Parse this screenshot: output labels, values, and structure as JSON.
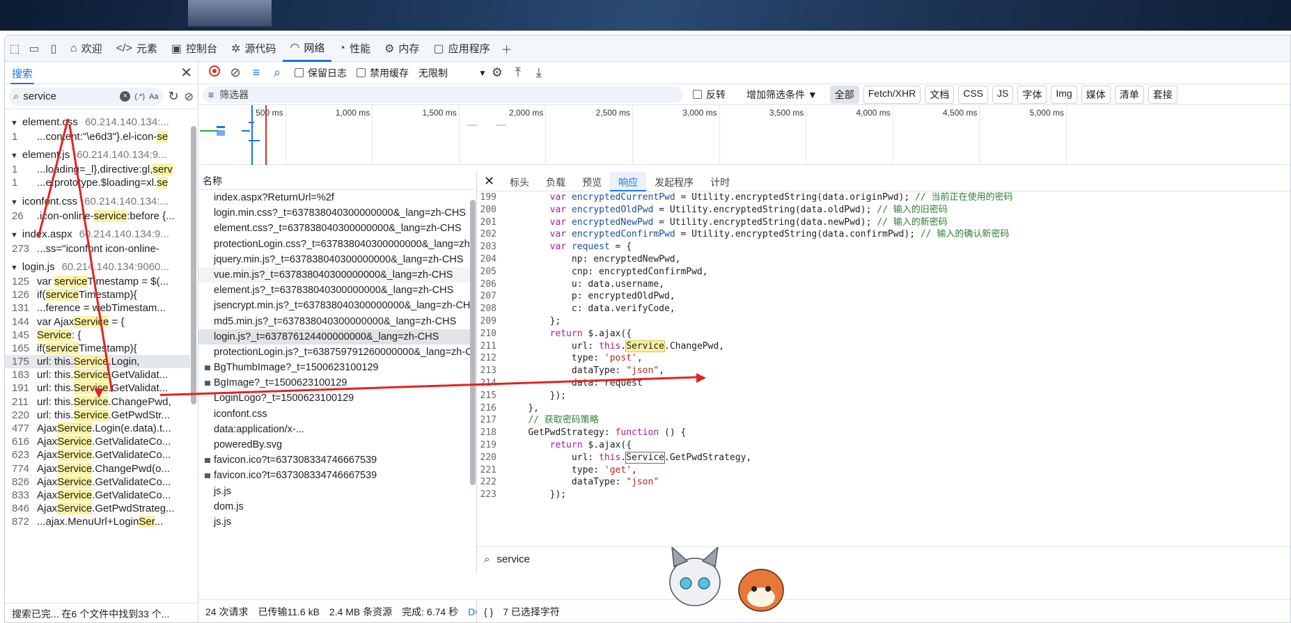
{
  "main_tabs": [
    {
      "label": "欢迎",
      "icon": "home-icon"
    },
    {
      "label": "元素",
      "icon": "code-icon"
    },
    {
      "label": "控制台",
      "icon": "console-icon"
    },
    {
      "label": "源代码",
      "icon": "bug-icon"
    },
    {
      "label": "网络",
      "icon": "wifi-icon"
    },
    {
      "label": "性能",
      "icon": "gauge-icon"
    },
    {
      "label": "内存",
      "icon": "memory-icon"
    },
    {
      "label": "应用程序",
      "icon": "app-icon"
    }
  ],
  "search": {
    "tab_label": "搜索",
    "query": "service",
    "regex_label": "(.*)",
    "case_label": "Aa",
    "status": "搜索已完... 在6 个文件中找到33 个..."
  },
  "search_results": [
    {
      "file": "element.css",
      "host": "60.214.140.134:...",
      "lines": [
        {
          "n": "1",
          "pre": "...content:\"\\e6d3\"}.el-icon-",
          "hl": "se",
          "post": ""
        }
      ]
    },
    {
      "file": "element.js",
      "host": "60.214.140.134:9...",
      "lines": [
        {
          "n": "1",
          "pre": "...loading=_l},directive:gl,",
          "hl": "serv",
          "post": ""
        },
        {
          "n": "1",
          "pre": "...e.prototype.$loading=xl.",
          "hl": "se",
          "post": ""
        }
      ]
    },
    {
      "file": "iconfont.css",
      "host": "60.214.140.134:...",
      "lines": [
        {
          "n": "26",
          "pre": ".icon-online-",
          "hl": "service",
          "post": ":before {..."
        }
      ]
    },
    {
      "file": "index.aspx",
      "host": "60.214.140.134:9...",
      "lines": [
        {
          "n": "273",
          "pre": "...ss=\"iconfont icon-online-",
          "hl": "",
          "post": ""
        }
      ]
    },
    {
      "file": "login.js",
      "host": "60.214.140.134:9060...",
      "lines": [
        {
          "n": "125",
          "pre": "var ",
          "hl": "service",
          "post": "Timestamp = $(..."
        },
        {
          "n": "126",
          "pre": "if(",
          "hl": "service",
          "post": "Timestamp){"
        },
        {
          "n": "131",
          "pre": "...ference = webTimestam...",
          "hl": "",
          "post": ""
        },
        {
          "n": "144",
          "pre": "var Ajax",
          "hl": "Service",
          "post": " = {"
        },
        {
          "n": "145",
          "pre": "",
          "hl": "Service",
          "post": ": {"
        },
        {
          "n": "165",
          "pre": "if(",
          "hl": "service",
          "post": "Timestamp){"
        },
        {
          "n": "175",
          "pre": "url: this.",
          "hl": "Service",
          "post": ".Login,"
        },
        {
          "n": "183",
          "pre": "url: this.",
          "hl": "Service",
          "post": ".GetValidat..."
        },
        {
          "n": "191",
          "pre": "url: this.",
          "hl": "Service",
          "post": ".GetValidat..."
        },
        {
          "n": "211",
          "pre": "url: this.",
          "hl": "Service",
          "post": ".ChangePwd,"
        },
        {
          "n": "220",
          "pre": "url: this.",
          "hl": "Service",
          "post": ".GetPwdStr..."
        },
        {
          "n": "477",
          "pre": "Ajax",
          "hl": "Service",
          "post": ".Login(e.data).t..."
        },
        {
          "n": "616",
          "pre": "Ajax",
          "hl": "Service",
          "post": ".GetValidateCo..."
        },
        {
          "n": "623",
          "pre": "Ajax",
          "hl": "Service",
          "post": ".GetValidateCo..."
        },
        {
          "n": "774",
          "pre": "Ajax",
          "hl": "Service",
          "post": ".ChangePwd(o..."
        },
        {
          "n": "826",
          "pre": "Ajax",
          "hl": "Service",
          "post": ".GetValidateCo..."
        },
        {
          "n": "833",
          "pre": "Ajax",
          "hl": "Service",
          "post": ".GetValidateCo..."
        },
        {
          "n": "846",
          "pre": "Ajax",
          "hl": "Service",
          "post": ".GetPwdStrateg..."
        },
        {
          "n": "872",
          "pre": "...ajax.MenuUrl+Login",
          "hl": "Ser",
          "post": "..."
        }
      ]
    }
  ],
  "toolbar": {
    "preserve_log": "保留日志",
    "disable_cache": "禁用缓存",
    "throttle": "无限制"
  },
  "filter": {
    "placeholder": "筛选器",
    "invert": "反转",
    "more_filters": "增加筛选条件",
    "types": [
      "全部",
      "Fetch/XHR",
      "文档",
      "CSS",
      "JS",
      "字体",
      "Img",
      "媒体",
      "清单",
      "套接"
    ]
  },
  "timeline_ticks": [
    "500 ms",
    "1,000 ms",
    "1,500 ms",
    "2,000 ms",
    "2,500 ms",
    "3,000 ms",
    "3,500 ms",
    "4,000 ms",
    "4,500 ms",
    "5,000 ms"
  ],
  "request_list": {
    "header": "名称",
    "rows": [
      {
        "name": "index.aspx?ReturnUrl=%2f",
        "img": false
      },
      {
        "name": "login.min.css?_t=637838040300000000&_lang=zh-CHS",
        "img": false
      },
      {
        "name": "element.css?_t=637838040300000000&_lang=zh-CHS",
        "img": false
      },
      {
        "name": "protectionLogin.css?_t=637838040300000000&_lang=zh-C...",
        "img": false
      },
      {
        "name": "jquery.min.js?_t=637838040300000000&_lang=zh-CHS",
        "img": false
      },
      {
        "name": "vue.min.js?_t=637838040300000000&_lang=zh-CHS",
        "img": false
      },
      {
        "name": "element.js?_t=637838040300000000&_lang=zh-CHS",
        "img": false
      },
      {
        "name": "jsencrypt.min.js?_t=637838040300000000&_lang=zh-CHS",
        "img": false
      },
      {
        "name": "md5.min.js?_t=637838040300000000&_lang=zh-CHS",
        "img": false
      },
      {
        "name": "login.js?_t=637876124400000000&_lang=zh-CHS",
        "img": false
      },
      {
        "name": "protectionLogin.js?_t=638759791260000000&_lang=zh-CHS",
        "img": false
      },
      {
        "name": "BgThumbImage?_t=1500623100129",
        "img": true
      },
      {
        "name": "BgImage?_t=1500623100129",
        "img": true
      },
      {
        "name": "LoginLogo?_t=1500623100129",
        "img": false
      },
      {
        "name": "iconfont.css",
        "img": false
      },
      {
        "name": "data:application/x-...",
        "img": false
      },
      {
        "name": "poweredBy.svg",
        "img": false
      },
      {
        "name": "favicon.ico?t=637308334746667539",
        "img": true
      },
      {
        "name": "favicon.ico?t=637308334746667539",
        "img": true
      },
      {
        "name": "js.js",
        "img": false
      },
      {
        "name": "dom.js",
        "img": false
      },
      {
        "name": "js.js",
        "img": false
      }
    ]
  },
  "net_status": {
    "requests": "24 次请求",
    "transferred": "已传输11.6 kB",
    "resources": "2.4 MB 条资源",
    "finish": "完成: 6.74 秒",
    "dom": "DOMCon"
  },
  "response_tabs": [
    "标头",
    "负载",
    "预览",
    "响应",
    "发起程序",
    "计时"
  ],
  "code_lines": [
    {
      "n": "199",
      "i": "        ",
      "segs": [
        [
          "kw",
          "var "
        ],
        [
          "vr",
          "encryptedCurrentPwd"
        ],
        [
          "t",
          " = Utility.encryptedString(data.originPwd); "
        ],
        [
          "cm",
          "// 当前正在使用的密码"
        ]
      ]
    },
    {
      "n": "200",
      "i": "        ",
      "segs": [
        [
          "kw",
          "var "
        ],
        [
          "vr",
          "encryptedOldPwd"
        ],
        [
          "t",
          " = Utility.encryptedString(data.oldPwd); "
        ],
        [
          "cm",
          "// 输入的旧密码"
        ]
      ]
    },
    {
      "n": "201",
      "i": "        ",
      "segs": [
        [
          "kw",
          "var "
        ],
        [
          "vr",
          "encryptedNewPwd"
        ],
        [
          "t",
          " = Utility.encryptedString(data.newPwd); "
        ],
        [
          "cm",
          "// 输入的新密码"
        ]
      ]
    },
    {
      "n": "202",
      "i": "        ",
      "segs": [
        [
          "kw",
          "var "
        ],
        [
          "vr",
          "encryptedConfirmPwd"
        ],
        [
          "t",
          " = Utility.encryptedString(data.confirmPwd); "
        ],
        [
          "cm",
          "// 输入的确认新密码"
        ]
      ]
    },
    {
      "n": "203",
      "i": "        ",
      "segs": [
        [
          "kw",
          "var "
        ],
        [
          "vr",
          "request"
        ],
        [
          "t",
          " = {"
        ]
      ]
    },
    {
      "n": "204",
      "i": "            ",
      "segs": [
        [
          "t",
          "np: encryptedNewPwd,"
        ]
      ]
    },
    {
      "n": "205",
      "i": "            ",
      "segs": [
        [
          "t",
          "cnp: encryptedConfirmPwd,"
        ]
      ]
    },
    {
      "n": "206",
      "i": "            ",
      "segs": [
        [
          "t",
          "u: data.username,"
        ]
      ]
    },
    {
      "n": "207",
      "i": "            ",
      "segs": [
        [
          "t",
          "p: encryptedOldPwd,"
        ]
      ]
    },
    {
      "n": "208",
      "i": "            ",
      "segs": [
        [
          "t",
          "c: data.verifyCode,"
        ]
      ]
    },
    {
      "n": "209",
      "i": "        ",
      "segs": [
        [
          "t",
          "};"
        ]
      ]
    },
    {
      "n": "210",
      "i": "        ",
      "segs": [
        [
          "kw",
          "return "
        ],
        [
          "t",
          "$.ajax({"
        ]
      ]
    },
    {
      "n": "211",
      "i": "            ",
      "segs": [
        [
          "t",
          "url: "
        ],
        [
          "kw",
          "this"
        ],
        [
          "t",
          "."
        ],
        [
          "shl",
          "Service"
        ],
        [
          "t",
          ".ChangePwd,"
        ]
      ]
    },
    {
      "n": "212",
      "i": "            ",
      "segs": [
        [
          "t",
          "type: "
        ],
        [
          "st",
          "'post'"
        ],
        [
          "t",
          ","
        ]
      ]
    },
    {
      "n": "213",
      "i": "            ",
      "segs": [
        [
          "t",
          "dataType: "
        ],
        [
          "st",
          "\"json\""
        ],
        [
          "t",
          ","
        ]
      ]
    },
    {
      "n": "214",
      "i": "            ",
      "segs": [
        [
          "t",
          "data: request"
        ]
      ]
    },
    {
      "n": "215",
      "i": "        ",
      "segs": [
        [
          "t",
          "});"
        ]
      ]
    },
    {
      "n": "216",
      "i": "    ",
      "segs": [
        [
          "t",
          "},"
        ]
      ]
    },
    {
      "n": "217",
      "i": "    ",
      "segs": [
        [
          "cm",
          "// 获取密码策略"
        ]
      ]
    },
    {
      "n": "218",
      "i": "    ",
      "segs": [
        [
          "t",
          "GetPwdStrategy: "
        ],
        [
          "kw",
          "function"
        ],
        [
          "t",
          " () {"
        ]
      ]
    },
    {
      "n": "219",
      "i": "        ",
      "segs": [
        [
          "kw",
          "return "
        ],
        [
          "t",
          "$.ajax({"
        ]
      ]
    },
    {
      "n": "220",
      "i": "            ",
      "segs": [
        [
          "t",
          "url: "
        ],
        [
          "kw",
          "this"
        ],
        [
          "t",
          "."
        ],
        [
          "sbox",
          "Service"
        ],
        [
          "t",
          ".GetPwdStrategy,"
        ]
      ]
    },
    {
      "n": "221",
      "i": "            ",
      "segs": [
        [
          "t",
          "type: "
        ],
        [
          "st",
          "'get'"
        ],
        [
          "t",
          ","
        ]
      ]
    },
    {
      "n": "222",
      "i": "            ",
      "segs": [
        [
          "t",
          "dataType: "
        ],
        [
          "st",
          "\"json\""
        ]
      ]
    },
    {
      "n": "223",
      "i": "        ",
      "segs": [
        [
          "t",
          "});"
        ]
      ]
    }
  ],
  "code_search": {
    "query": "service"
  },
  "resp_status": {
    "braces": "{ }",
    "selected": "7 已选择字符"
  }
}
